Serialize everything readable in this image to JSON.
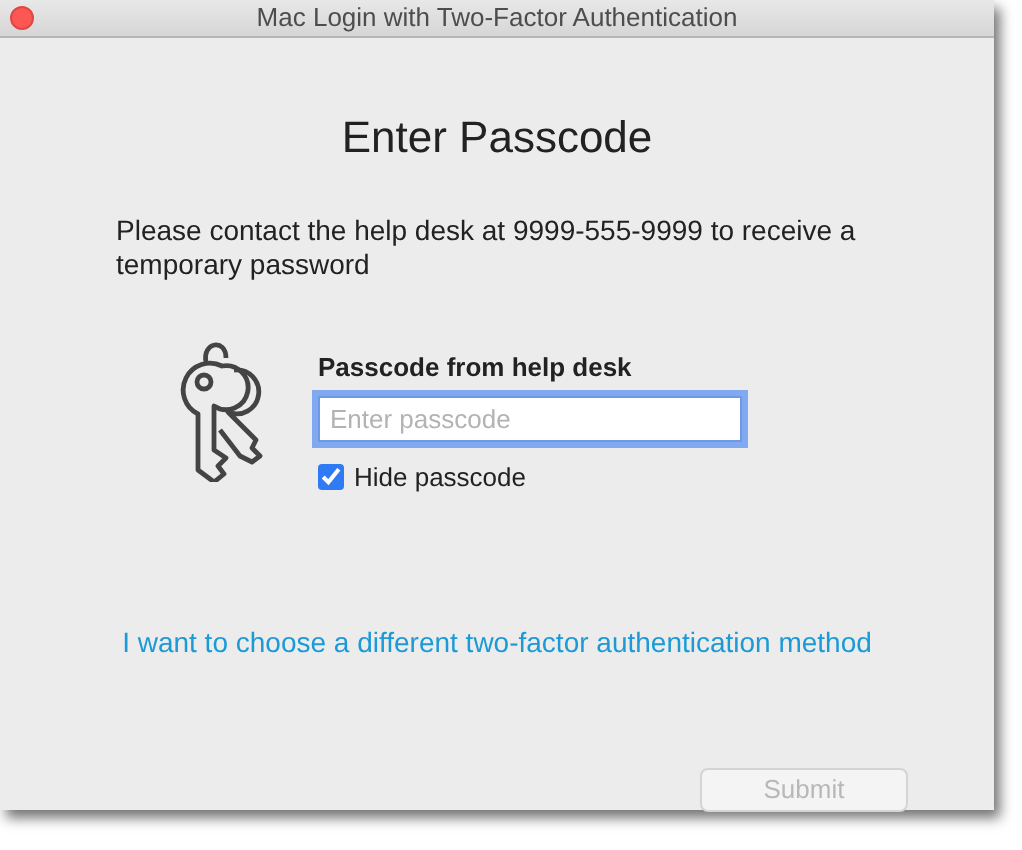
{
  "window": {
    "title": "Mac Login with Two-Factor Authentication"
  },
  "heading": "Enter Passcode",
  "instruction": "Please contact the help desk at 9999-555-9999 to receive a temporary password",
  "passcode": {
    "label": "Passcode from help desk",
    "placeholder": "Enter passcode",
    "focused": true
  },
  "hide_passcode": {
    "label": "Hide passcode",
    "checked": true
  },
  "link": "I want to choose a different two-factor authentication method",
  "submit": {
    "label": "Submit",
    "disabled": true
  }
}
